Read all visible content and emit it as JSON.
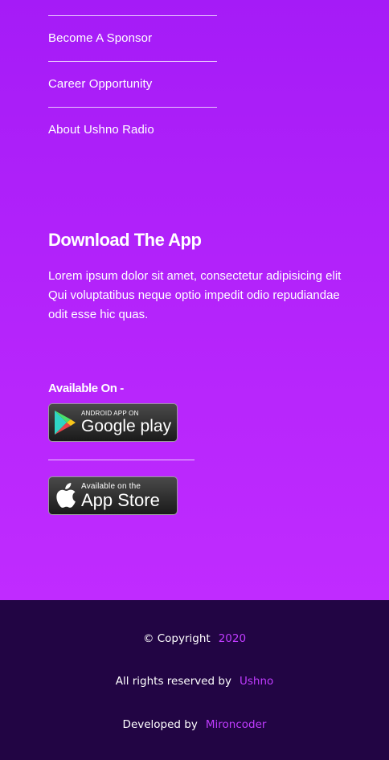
{
  "menu": {
    "items": [
      {
        "label": "Become A Sponsor"
      },
      {
        "label": "Career Opportunity"
      },
      {
        "label": "About Ushno Radio"
      }
    ]
  },
  "download": {
    "title": "Download The App",
    "text": "Lorem ipsum dolor sit amet, consectetur adipisicing elit Qui voluptatibus neque optio impedit odio repudiandae odit esse hic quas.",
    "available_label": "Available On -",
    "google_play": {
      "small": "ANDROID APP ON",
      "big": "Google play"
    },
    "app_store": {
      "small": "Available on the",
      "big": "App Store"
    }
  },
  "footer": {
    "copyright_label": "© Copyright",
    "year": "2020",
    "rights_label": "All rights reserved by",
    "rights_owner": "Ushno",
    "developed_label": "Developed by",
    "developer": "Mironcoder"
  },
  "colors": {
    "gradient_top": "#a51bf7",
    "gradient_bottom": "#c02bff",
    "footer_bg": "#220544",
    "highlight": "#c03cff"
  }
}
